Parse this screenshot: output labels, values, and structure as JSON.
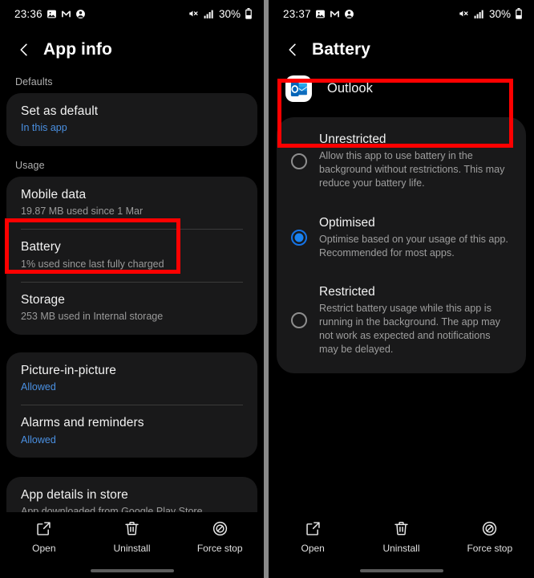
{
  "colors": {
    "accent_blue": "#1a82f0",
    "link_blue": "#4a90e2",
    "highlight_red": "#fe0000",
    "card_bg": "#19191a",
    "screen_bg": "#000000"
  },
  "left_panel": {
    "statusbar": {
      "time": "23:36",
      "battery_percent": "30%",
      "left_icons": [
        "image-icon",
        "messaging-icon",
        "contact-icon"
      ],
      "right_icons": [
        "mute-icon",
        "signal-bars-icon",
        "battery-icon"
      ]
    },
    "header": {
      "back": "back-icon",
      "title": "App info"
    },
    "sections": [
      {
        "label": "Defaults",
        "rows": [
          {
            "title": "Set as default",
            "sub": "In this app",
            "sub_is_link": true
          }
        ]
      },
      {
        "label": "Usage",
        "rows": [
          {
            "title": "Mobile data",
            "sub": "19.87 MB used since 1 Mar",
            "sub_is_link": false
          },
          {
            "title": "Battery",
            "sub": "1% used since last fully charged",
            "sub_is_link": false
          },
          {
            "title": "Storage",
            "sub": "253 MB used in Internal storage",
            "sub_is_link": false
          }
        ]
      },
      {
        "label": "",
        "rows": [
          {
            "title": "Picture-in-picture",
            "sub": "Allowed",
            "sub_is_link": true
          },
          {
            "title": "Alarms and reminders",
            "sub": "Allowed",
            "sub_is_link": true
          }
        ]
      },
      {
        "label": "",
        "rows": [
          {
            "title": "App details in store",
            "sub": "App downloaded from Google Play Store",
            "sub_is_link": false
          }
        ]
      }
    ],
    "actions": [
      {
        "label": "Open",
        "icon": "open-external-icon"
      },
      {
        "label": "Uninstall",
        "icon": "trash-icon"
      },
      {
        "label": "Force stop",
        "icon": "force-stop-icon"
      }
    ]
  },
  "right_panel": {
    "statusbar": {
      "time": "23:37",
      "battery_percent": "30%",
      "left_icons": [
        "image-icon",
        "messaging-icon",
        "contact-icon"
      ],
      "right_icons": [
        "mute-icon",
        "signal-bars-icon",
        "battery-icon"
      ]
    },
    "header": {
      "back": "back-icon",
      "title": "Battery"
    },
    "app": {
      "name": "Outlook",
      "icon": "outlook-icon"
    },
    "options": [
      {
        "title": "Unrestricted",
        "desc": "Allow this app to use battery in the background without restrictions. This may reduce your battery life.",
        "selected": false
      },
      {
        "title": "Optimised",
        "desc": "Optimise based on your usage of this app. Recommended for most apps.",
        "selected": true
      },
      {
        "title": "Restricted",
        "desc": "Restrict battery usage while this app is running in the background. The app may not work as expected and notifications may be delayed.",
        "selected": false
      }
    ],
    "actions": [
      {
        "label": "Open",
        "icon": "open-external-icon"
      },
      {
        "label": "Uninstall",
        "icon": "trash-icon"
      },
      {
        "label": "Force stop",
        "icon": "force-stop-icon"
      }
    ]
  }
}
